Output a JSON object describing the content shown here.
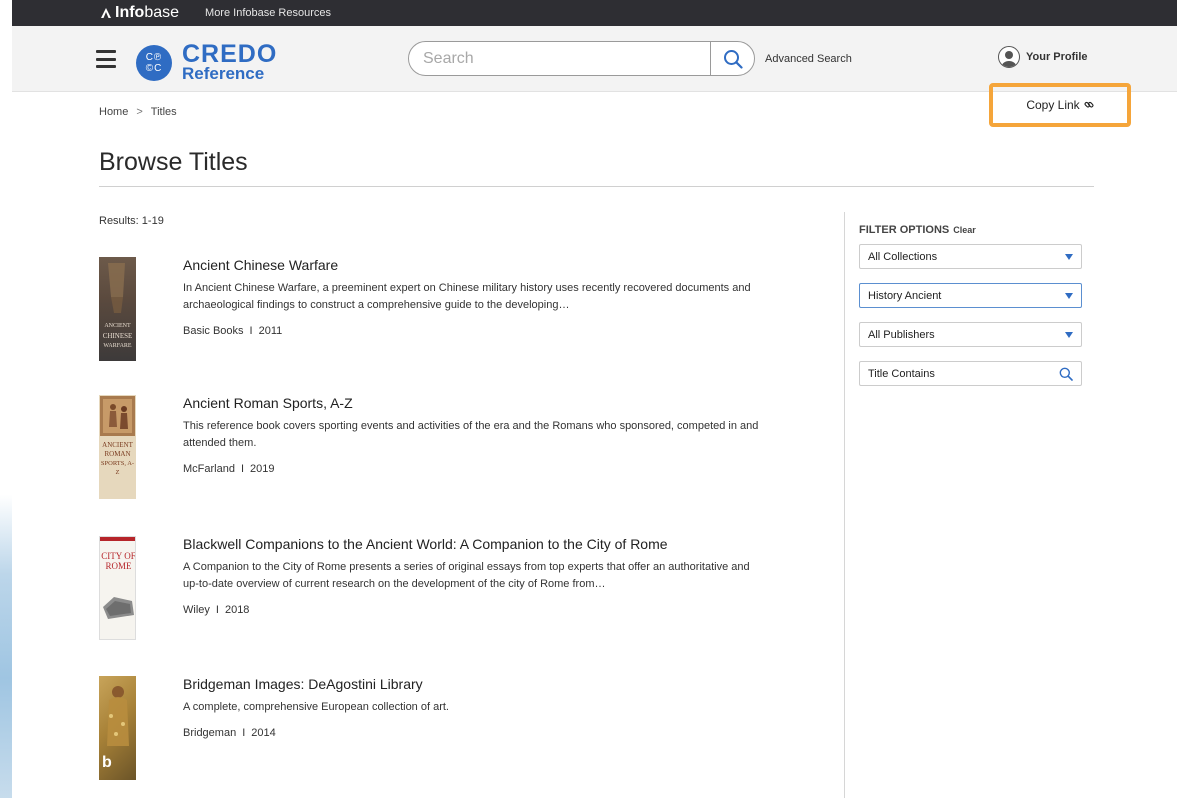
{
  "topbar": {
    "brand_bold": "Info",
    "brand_thin": "base",
    "more_resources": "More Infobase Resources"
  },
  "header": {
    "logo_line1": "CREDO",
    "logo_line2": "Reference",
    "search_placeholder": "Search",
    "advanced_search": "Advanced Search",
    "profile_label": "Your Profile"
  },
  "breadcrumb": {
    "home": "Home",
    "separator": ">",
    "current": "Titles"
  },
  "copy_link": "Copy Link",
  "page_title": "Browse Titles",
  "results_label": "Results: 1-19",
  "items": [
    {
      "title": "Ancient Chinese Warfare",
      "description": "In Ancient Chinese Warfare, a preeminent expert on Chinese military history uses recently recovered documents and archaeological findings to construct a comprehensive guide to the developing…",
      "publisher": "Basic Books",
      "year": "2011",
      "cover_text": [
        "ANCIENT",
        "CHINESE",
        "WARFARE"
      ]
    },
    {
      "title": "Ancient Roman Sports, A-Z",
      "description": "This reference book covers sporting events and activities of the era and the Romans who sponsored, competed in and attended them.",
      "publisher": "McFarland",
      "year": "2019",
      "cover_text": [
        "ANCIENT",
        "ROMAN",
        "SPORTS, A-Z"
      ]
    },
    {
      "title": "Blackwell Companions to the Ancient World: A Companion to the City of Rome",
      "description": "A Companion to the City of Rome presents a series of original essays from top experts that offer an authoritative and up-to-date overview of current research on the development of the city of Rome from…",
      "publisher": "Wiley",
      "year": "2018",
      "cover_text": [
        "CITY OF",
        "ROME"
      ]
    },
    {
      "title": "Bridgeman Images: DeAgostini Library",
      "description": "A complete, comprehensive European collection of art.",
      "publisher": "Bridgeman",
      "year": "2014",
      "cover_text": [
        "b"
      ]
    }
  ],
  "filter": {
    "heading": "FILTER OPTIONS",
    "clear": "Clear",
    "collections": "All Collections",
    "subject": "History Ancient",
    "publishers": "All Publishers",
    "title_contains": "Title Contains"
  },
  "meta_separator": "I",
  "colors": {
    "brand_blue": "#2f6cc3",
    "highlight_orange": "#f5a53a",
    "topbar": "#2e2e33"
  }
}
